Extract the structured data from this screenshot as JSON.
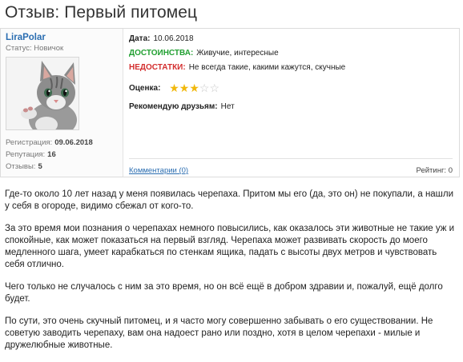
{
  "title": "Отзыв: Первый питомец",
  "user": {
    "name": "LiraPolar",
    "status": "Статус: Новичок",
    "registration_label": "Регистрация:",
    "registration_value": "09.06.2018",
    "reputation_label": "Репутация:",
    "reputation_value": "16",
    "reviews_label": "Отзывы:",
    "reviews_value": "5"
  },
  "details": {
    "date_label": "Дата:",
    "date_value": "10.06.2018",
    "pros_label": "ДОСТОИНСТВА:",
    "pros_value": "Живучие, интересные",
    "cons_label": "НЕДОСТАТКИ:",
    "cons_value": "Не всегда такие, какими кажутся, скучные",
    "score_label": "Оценка:",
    "score_value": 3,
    "score_max": 5,
    "recommend_label": "Рекомендую друзьям:",
    "recommend_value": "Нет",
    "comments_link": "Комментарии (0)",
    "rating": "Рейтинг: 0"
  },
  "colors": {
    "link": "#2a6db1",
    "pros": "#22a032",
    "cons": "#d32f2f",
    "star_on": "#f1b80d",
    "star_off": "#c8c8c8"
  },
  "body": {
    "p1": "Где-то около 10 лет назад у меня появилась черепаха. Притом мы его (да, это он) не покупали, а нашли у себя в огороде, видимо сбежал от кого-то.",
    "p2": "За это время мои познания о черепахах немного повысились, как оказалось эти животные не такие уж и спокойные, как может показаться на первый взгляд. Черепаха может развивать скорость до моего медленного шага, умеет карабкаться по стенкам ящика, падать с высоты двух метров и чувствовать себя отлично.",
    "p3": "Чего только не случалось с ним за это время, но он всё ещё в добром здравии и, пожалуй, ещё долго будет.",
    "p4": "По сути, это очень скучный питомец, и я часто могу совершенно забывать о его существовании. Не советую заводить черепаху, вам она надоест рано или поздно, хотя в целом черепахи - милые и дружелюбные животные."
  }
}
